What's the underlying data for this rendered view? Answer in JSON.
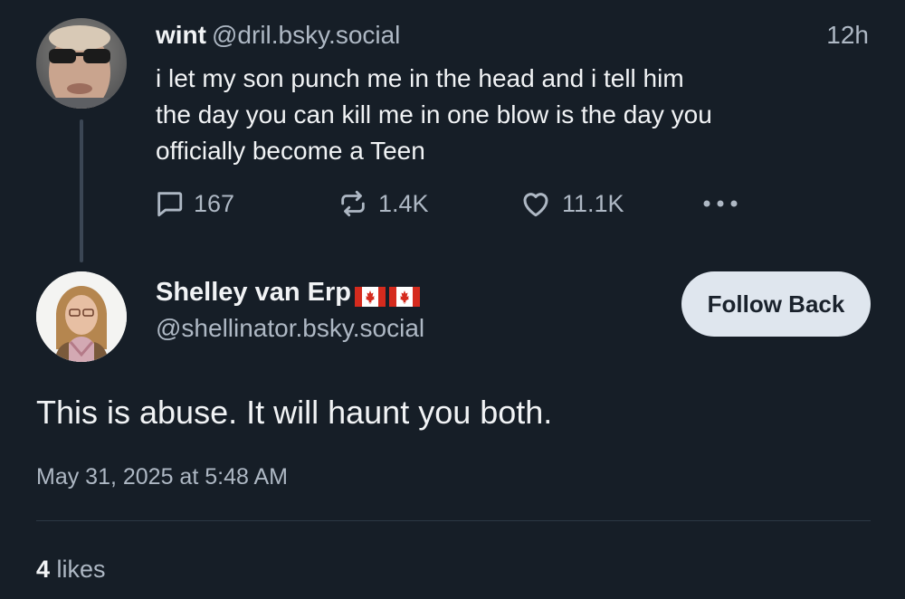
{
  "parent_post": {
    "author_name": "wint",
    "author_handle": "@dril.bsky.social",
    "time": "12h",
    "text": "i let my son punch me in the head and i tell him\nthe day you can kill me in one blow is the day you\nofficially become a Teen",
    "reply_count": "167",
    "repost_count": "1.4K",
    "like_count": "11.1K",
    "icons": {
      "reply": "reply-icon",
      "repost": "repost-icon",
      "like": "heart-icon",
      "more": "more-options-icon"
    }
  },
  "reply_post": {
    "author_name": "Shelley van Erp",
    "author_flags": [
      "canada-flag-icon",
      "canada-flag-icon"
    ],
    "author_handle": "@shellinator.bsky.social",
    "follow_button_label": "Follow Back",
    "text": "This is abuse. It will haunt you both.",
    "timestamp": "May 31, 2025 at 5:48 AM",
    "likes_count": "4",
    "likes_label": "likes"
  },
  "colors": {
    "background": "#161e27",
    "text_primary": "#f1f3f5",
    "text_secondary": "#aeb8c4",
    "follow_button_bg": "#dfe6ee",
    "flag_red": "#d52b1e"
  }
}
